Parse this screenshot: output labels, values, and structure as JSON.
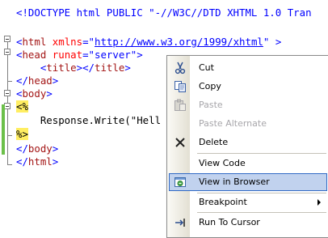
{
  "editor": {
    "lines": [
      {
        "segments": [
          {
            "t": "<!DOCTYPE html PUBLIC \"-//W3C//DTD XHTML 1.0 Tran",
            "c": "c-blue"
          }
        ]
      },
      {
        "segments": []
      },
      {
        "segments": [
          {
            "t": "<",
            "c": "c-blue"
          },
          {
            "t": "html",
            "c": "c-maroon"
          },
          {
            "t": " ",
            "c": "c-black"
          },
          {
            "t": "xmlns",
            "c": "c-red"
          },
          {
            "t": "=\"",
            "c": "c-blue"
          },
          {
            "t": "http://www.w3.org/1999/xhtml",
            "c": "c-url"
          },
          {
            "t": "\"",
            "c": "c-blue"
          },
          {
            "t": " >",
            "c": "c-blue"
          }
        ]
      },
      {
        "segments": [
          {
            "t": "<",
            "c": "c-blue"
          },
          {
            "t": "head",
            "c": "c-maroon"
          },
          {
            "t": " ",
            "c": "c-black"
          },
          {
            "t": "runat",
            "c": "c-red"
          },
          {
            "t": "=\"server\">",
            "c": "c-blue"
          }
        ]
      },
      {
        "segments": [
          {
            "t": "    <",
            "c": "c-blue"
          },
          {
            "t": "title",
            "c": "c-maroon"
          },
          {
            "t": "></",
            "c": "c-blue"
          },
          {
            "t": "title",
            "c": "c-maroon"
          },
          {
            "t": ">",
            "c": "c-blue"
          }
        ]
      },
      {
        "segments": [
          {
            "t": "</",
            "c": "c-blue"
          },
          {
            "t": "head",
            "c": "c-maroon"
          },
          {
            "t": ">",
            "c": "c-blue"
          }
        ]
      },
      {
        "segments": [
          {
            "t": "<",
            "c": "c-blue"
          },
          {
            "t": "body",
            "c": "c-maroon"
          },
          {
            "t": ">",
            "c": "c-blue"
          }
        ]
      },
      {
        "segments": [
          {
            "t": "<%",
            "c": "c-black delim"
          }
        ]
      },
      {
        "segments": [
          {
            "t": "    Response.Write(\"Hell",
            "c": "c-black"
          }
        ]
      },
      {
        "segments": [
          {
            "t": "%>",
            "c": "c-black delim"
          }
        ]
      },
      {
        "segments": [
          {
            "t": "</",
            "c": "c-blue"
          },
          {
            "t": "body",
            "c": "c-maroon"
          },
          {
            "t": ">",
            "c": "c-blue"
          }
        ]
      },
      {
        "segments": [
          {
            "t": "</",
            "c": "c-blue"
          },
          {
            "t": "html",
            "c": "c-maroon"
          },
          {
            "t": ">",
            "c": "c-blue"
          }
        ]
      }
    ]
  },
  "context_menu": {
    "cut": {
      "label": "Cut",
      "icon": "scissors-icon"
    },
    "copy": {
      "label": "Copy",
      "icon": "copy-icon"
    },
    "paste": {
      "label": "Paste",
      "icon": "paste-icon"
    },
    "paste_alternate": {
      "label": "Paste Alternate"
    },
    "delete": {
      "label": "Delete",
      "icon": "delete-x-icon"
    },
    "view_code": {
      "label": "View Code"
    },
    "view_in_browser": {
      "label": "View in Browser",
      "icon": "browser-icon"
    },
    "breakpoint": {
      "label": "Breakpoint"
    },
    "run_to_cursor": {
      "label": "Run To Cursor",
      "icon": "run-to-cursor-icon"
    }
  },
  "colors": {
    "highlight": "#c1d2ee",
    "highlight_border": "#316ac5",
    "delimiter_bg": "#ffee62",
    "change_bar": "#6cc04a"
  }
}
